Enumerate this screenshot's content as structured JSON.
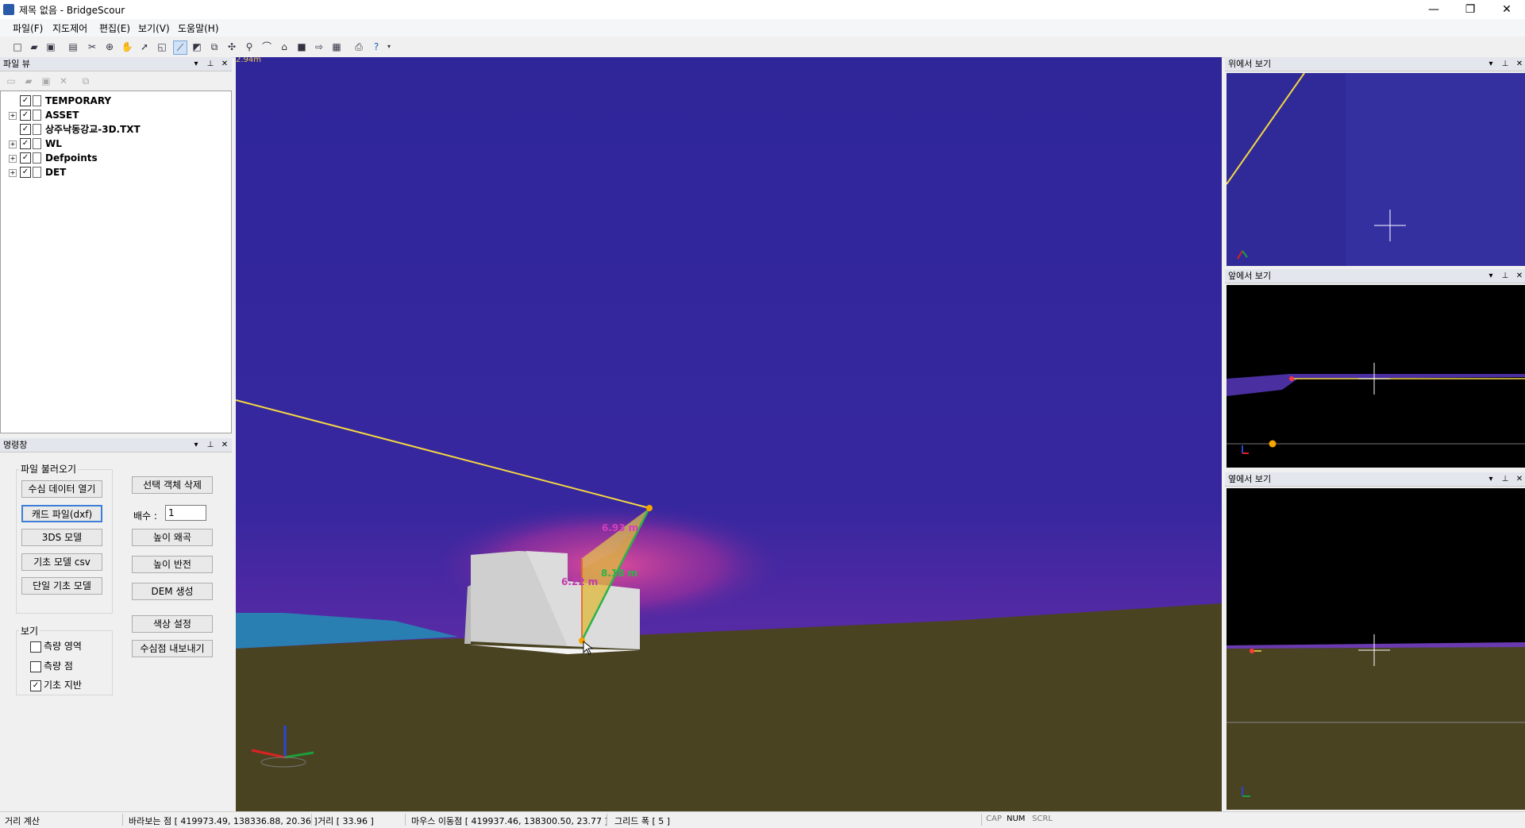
{
  "window": {
    "title": "제목 없음 - BridgeScour",
    "minimize": "—",
    "maximize": "❐",
    "close": "✕"
  },
  "menu": [
    "파일(F)",
    "지도제어",
    "편집(E)",
    "보기(V)",
    "도움말(H)"
  ],
  "file_view": {
    "title": "파일 뷰",
    "items": [
      {
        "label": "TEMPORARY",
        "checked": true,
        "expandable": false
      },
      {
        "label": "ASSET",
        "checked": true,
        "expandable": true
      },
      {
        "label": "상주낙동강교-3D.TXT",
        "checked": true,
        "expandable": false
      },
      {
        "label": "WL",
        "checked": true,
        "expandable": true
      },
      {
        "label": "Defpoints",
        "checked": true,
        "expandable": true
      },
      {
        "label": "DET",
        "checked": true,
        "expandable": true
      }
    ]
  },
  "command_panel": {
    "title": "명령창",
    "load_group_label": "파일 불러오기",
    "load_buttons": [
      "수심 데이터 열기",
      "캐드 파일(dxf)",
      "3DS 모델",
      "기초 모델 csv",
      "단일 기초 모델"
    ],
    "delete_button": "선택 객체 삭제",
    "multiplier_label": "배수 :",
    "multiplier_value": "1",
    "action_buttons": [
      "높이 왜곡",
      "높이 반전",
      "DEM 생성",
      "색상 설정",
      "수심점 내보내기"
    ],
    "view_group_label": "보기",
    "view_checks": [
      {
        "label": "측량 영역",
        "checked": false
      },
      {
        "label": "측량 점",
        "checked": false
      },
      {
        "label": "기초 지반",
        "checked": true
      }
    ]
  },
  "viewport": {
    "corner_text": "2.94m",
    "measurements": [
      "6.93 m",
      "6.22 m",
      "8.18 m"
    ]
  },
  "side_views": [
    {
      "title": "위에서 보기"
    },
    {
      "title": "앞에서 보기"
    },
    {
      "title": "옆에서 보기"
    }
  ],
  "status": {
    "mode": "거리 계산",
    "look_point": "바라보는 점 [ 419973.49, 138336.88, 20.36 ]",
    "distance": "거리 [ 33.96 ]",
    "mouse_point": "마우스 이동점 [ 419937.46, 138300.50, 23.77 ]",
    "grid_width": "그리드 폭 [ 5 ]",
    "indicators": [
      {
        "label": "CAP",
        "on": false
      },
      {
        "label": "NUM",
        "on": true
      },
      {
        "label": "SCRL",
        "on": false
      }
    ]
  },
  "colors": {
    "sky": "#33289a",
    "ground": "#4a4322",
    "highlight_line": "#f5d742",
    "measure_green": "#2bb34a"
  }
}
